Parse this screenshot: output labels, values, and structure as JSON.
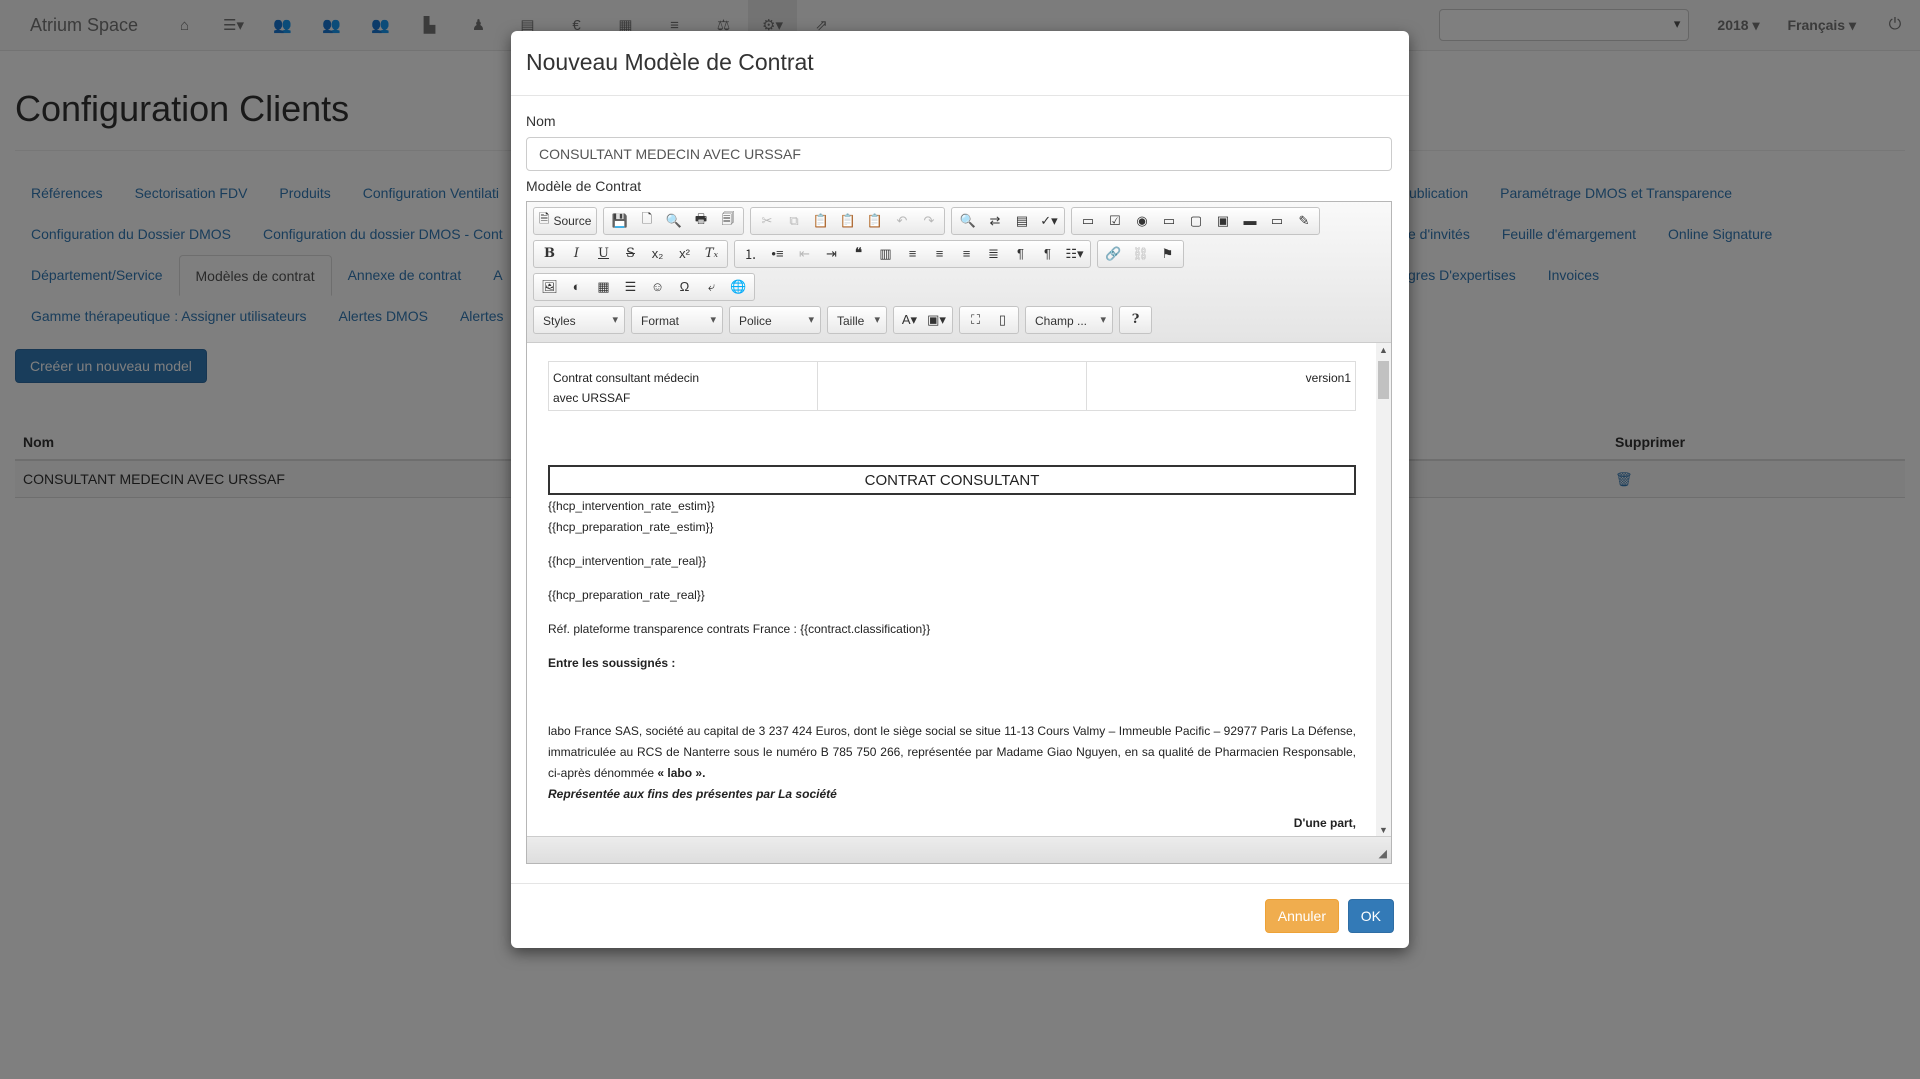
{
  "app": {
    "brand": "Atrium Space",
    "nav_icons": [
      "home-icon",
      "list-icon",
      "group-icon",
      "group-icon",
      "group-icon",
      "factory-icon",
      "person-icon",
      "document-icon",
      "euro-icon",
      "server-icon",
      "menu-icon",
      "scale-icon",
      "gears-icon",
      "share-icon"
    ],
    "year": "2018",
    "language": "Français"
  },
  "page": {
    "title": "Configuration Clients",
    "tabs_row1": [
      "Références",
      "Sectorisation FDV",
      "Produits",
      "Configuration Ventilati",
      "ublication",
      "Paramétrage DMOS et Transparence"
    ],
    "tabs_row2": [
      "Configuration du Dossier DMOS",
      "Configuration du dossier DMOS - Cont",
      "e d'invités",
      "Feuille d'émargement",
      "Online Signature"
    ],
    "tabs_row3": [
      "Département/Service",
      "Modèles de contrat",
      "Annexe de contrat",
      "A",
      "gres D'expertises",
      "Invoices"
    ],
    "tabs_row4": [
      "Gamme thérapeutique : Assigner utilisateurs",
      "Alertes DMOS",
      "Alertes"
    ],
    "create_button": "Creéer un nouveau model",
    "table": {
      "col_name": "Nom",
      "col_delete": "Supprimer",
      "rows": [
        {
          "name": "CONSULTANT MEDECIN AVEC URSSAF"
        }
      ]
    }
  },
  "modal": {
    "title": "Nouveau Modèle de Contrat",
    "name_label": "Nom",
    "name_value": "CONSULTANT MEDECIN AVEC URSSAF",
    "template_label": "Modèle de Contrat",
    "toolbar": {
      "source_label": "Source",
      "combos": [
        "Styles",
        "Format",
        "Police",
        "Taille"
      ],
      "field_combo": "Champ ...",
      "help": "?"
    },
    "document": {
      "header_left_line1": "Contrat consultant médecin",
      "header_left_line2": "avec URSSAF",
      "header_right": "version1",
      "boxed_title": "CONTRAT CONSULTANT",
      "line1": "{{hcp_intervention_rate_estim}}",
      "line2": "{{hcp_preparation_rate_estim}}",
      "line3": "{{hcp_intervention_rate_real}}",
      "line4": "{{hcp_preparation_rate_real}}",
      "ref_line": "Réf. plateforme transparence contrats France : {{contract.classification}}",
      "parties_heading": "Entre les soussignés :",
      "para_text": "labo France SAS, société au capital de 3 237 424 Euros, dont le siège social se situe 11-13 Cours Valmy – Immeuble Pacific – 92977 Paris La Défense, immatriculée au RCS de Nanterre sous le numéro B 785 750 266, représentée par Madame Giao Nguyen, en sa qualité de Pharmacien Responsable, ci-après dénommée ",
      "para_bold": "« labo ».",
      "represented": "Représentée aux fins des présentes par La société",
      "part_one": "D'une part,"
    },
    "cancel_button": "Annuler",
    "ok_button": "OK"
  }
}
